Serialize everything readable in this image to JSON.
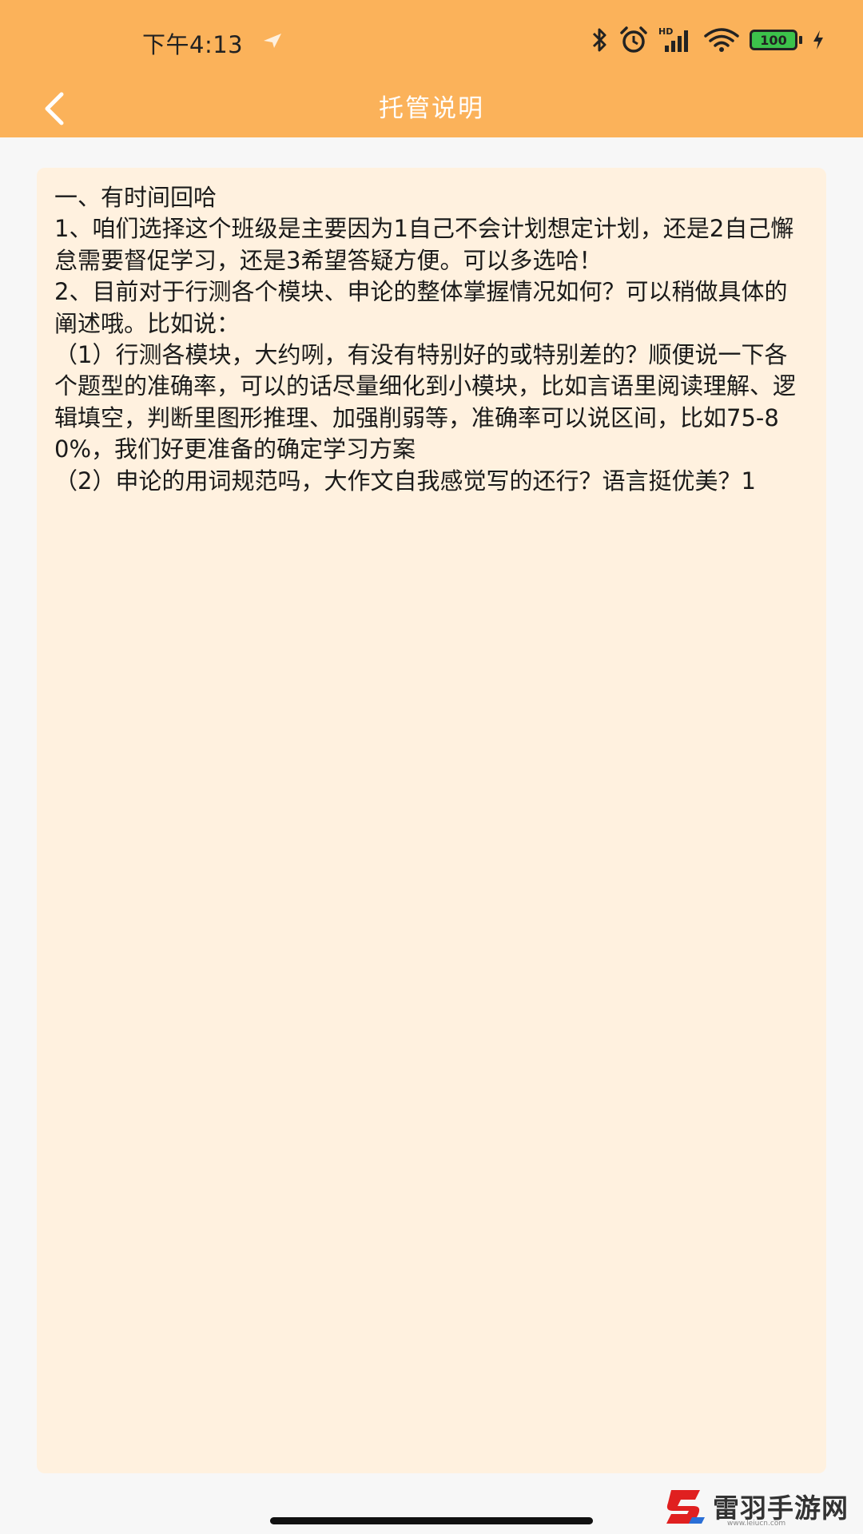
{
  "status_bar": {
    "time": "下午4:13",
    "icons": [
      "location-arrow-icon",
      "bluetooth-icon",
      "alarm-icon",
      "hd-signal-icon",
      "wifi-icon",
      "battery-icon",
      "charging-icon"
    ],
    "signal_label": "HD",
    "battery_level": "100"
  },
  "header": {
    "background": "#fbb25a",
    "title": "托管说明"
  },
  "content": {
    "text": "一、有时间回哈\n1、咱们选择这个班级是主要因为1自己不会计划想定计划，还是2自己懈怠需要督促学习，还是3希望答疑方便。可以多选哈！\n2、目前对于行测各个模块、申论的整体掌握情况如何？可以稍做具体的阐述哦。比如说：\n（1）行测各模块，大约咧，有没有特别好的或特别差的？顺便说一下各个题型的准确率，可以的话尽量细化到小模块，比如言语里阅读理解、逻辑填空，判断里图形推理、加强削弱等，准确率可以说区间，比如75-80%，我们好更准备的确定学习方案\n（2）申论的用词规范吗，大作文自我感觉写的还行？语言挺优美？1"
  },
  "watermark": {
    "text": "雷羽手游网",
    "url": "www.leiucn.com"
  }
}
